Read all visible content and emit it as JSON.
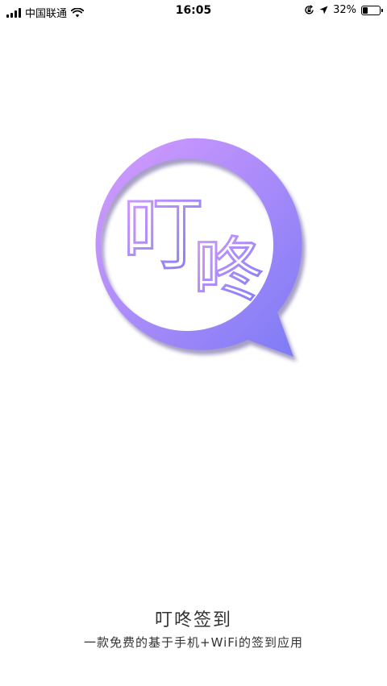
{
  "status_bar": {
    "carrier": "中国联通",
    "time": "16:05",
    "battery_text": "32%",
    "battery_level": 0.32,
    "icons": [
      "signal-icon",
      "wifi-icon",
      "orientation-lock-icon",
      "location-arrow-icon",
      "battery-icon"
    ]
  },
  "logo": {
    "char_1": "叮",
    "char_2": "咚",
    "gradient_start": "#D69BFF",
    "gradient_end": "#7D7BF5"
  },
  "app": {
    "title": "叮咚签到",
    "subtitle": "一款免费的基于手机+WiFi的签到应用"
  }
}
